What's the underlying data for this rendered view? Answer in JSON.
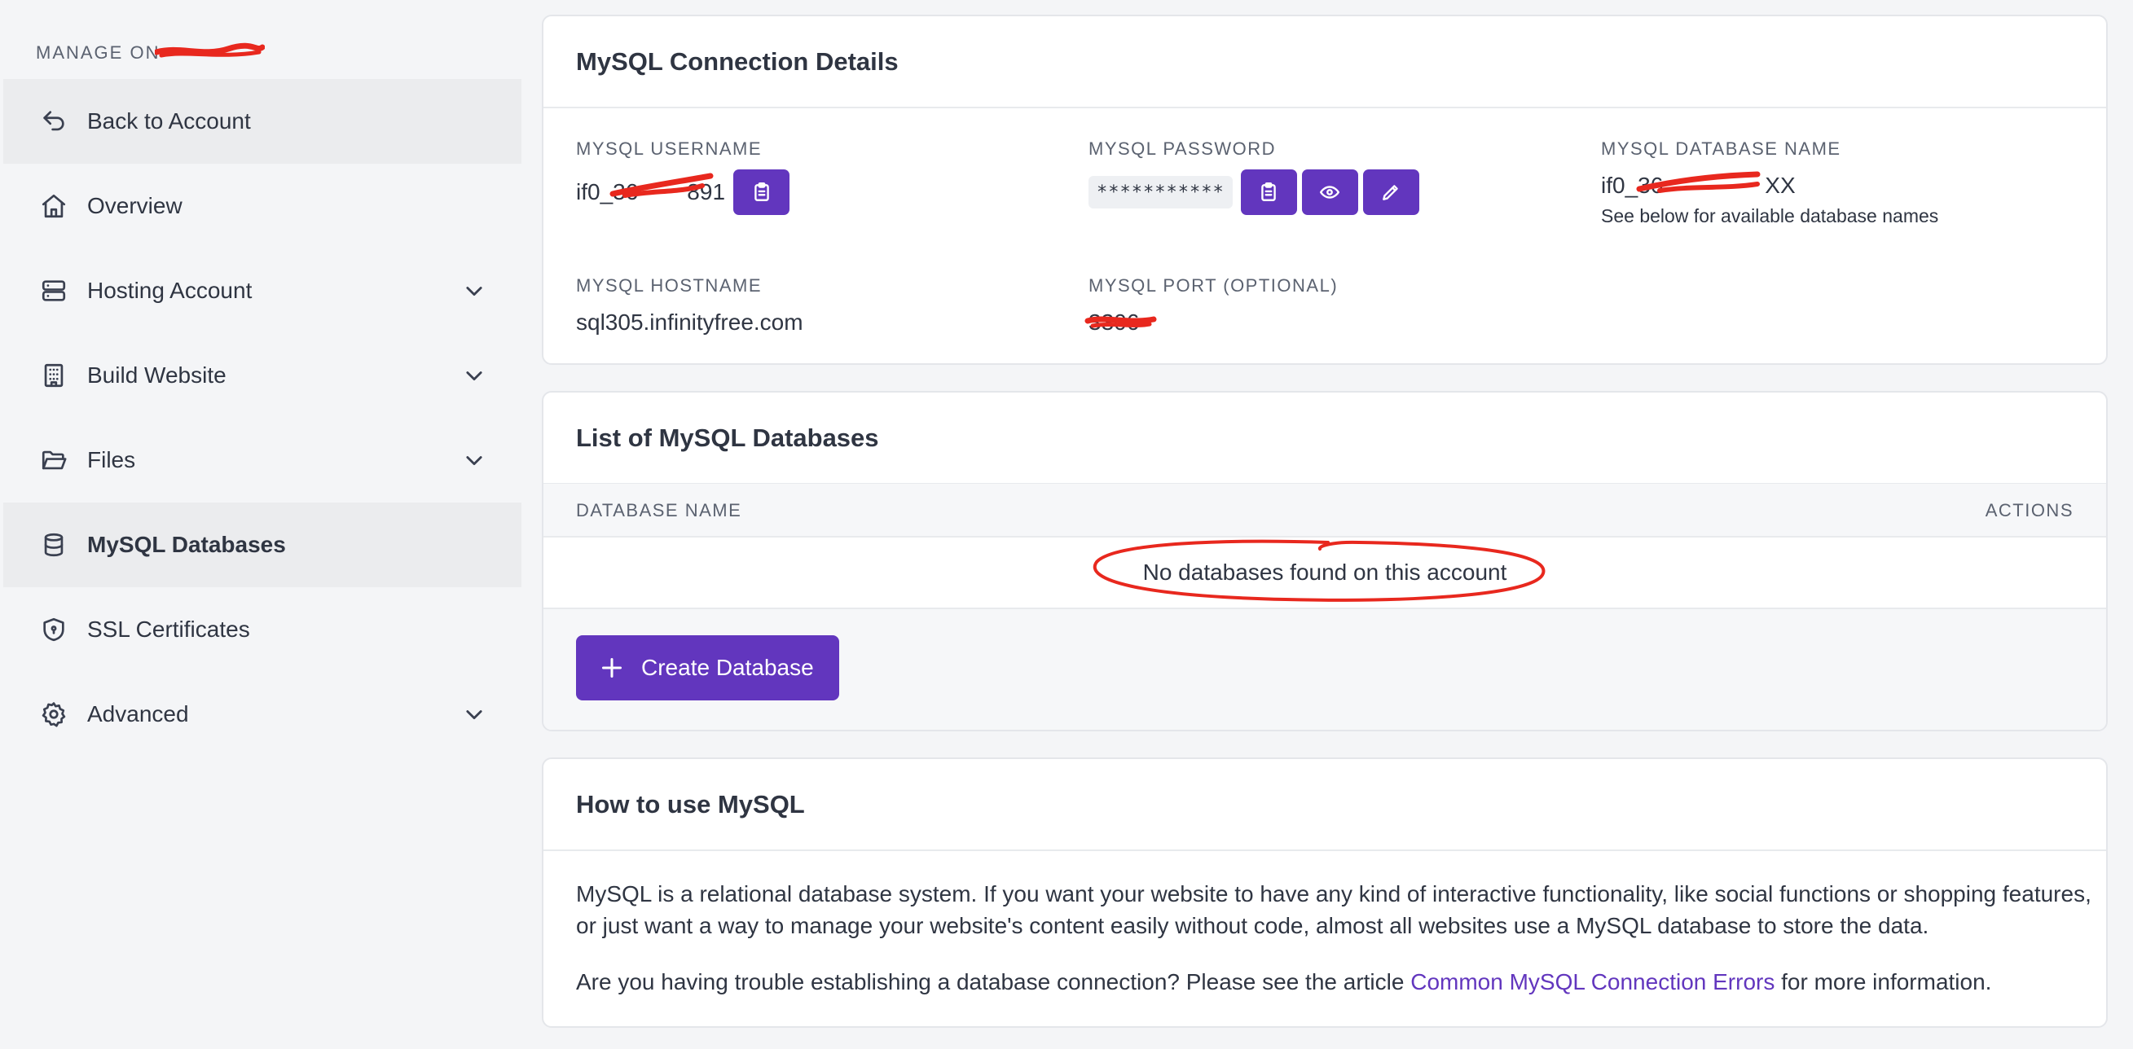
{
  "sidebar": {
    "heading": "MANAGE ON",
    "items": [
      {
        "label": "Back to Account",
        "icon": "back-arrow-icon"
      },
      {
        "label": "Overview",
        "icon": "home-icon"
      },
      {
        "label": "Hosting Account",
        "icon": "server-icon"
      },
      {
        "label": "Build Website",
        "icon": "building-icon"
      },
      {
        "label": "Files",
        "icon": "folder-icon"
      },
      {
        "label": "MySQL Databases",
        "icon": "database-icon"
      },
      {
        "label": "SSL Certificates",
        "icon": "shield-icon"
      },
      {
        "label": "Advanced",
        "icon": "gear-icon"
      }
    ]
  },
  "connection": {
    "title": "MySQL Connection Details",
    "username_label": "MYSQL USERNAME",
    "username_value": "if0_36",
    "username_suffix": "891",
    "password_label": "MYSQL PASSWORD",
    "password_value": "***********",
    "dbname_label": "MYSQL DATABASE NAME",
    "dbname_value": "if0_36",
    "dbname_suffix": "XX",
    "dbname_note": "See below for available database names",
    "hostname_label": "MYSQL HOSTNAME",
    "hostname_value": "sql305.infinityfree.com",
    "port_label": "MYSQL PORT (OPTIONAL)",
    "port_value": "3306"
  },
  "databases": {
    "title": "List of MySQL Databases",
    "col_name": "DATABASE NAME",
    "col_actions": "ACTIONS",
    "empty_message": "No databases found on this account",
    "create_label": "Create Database"
  },
  "howto": {
    "title": "How to use MySQL",
    "para1": "MySQL is a relational database system. If you want your website to have any kind of interactive functionality, like social functions or shopping features, or just want a way to manage your website's content easily without code, almost all websites use a MySQL database to store the data.",
    "para2_before": "Are you having trouble establishing a database connection? Please see the article ",
    "para2_link": "Common MySQL Connection Errors",
    "para2_after": " for more information."
  },
  "colors": {
    "accent": "#6236be",
    "annotation": "#e8281e"
  }
}
